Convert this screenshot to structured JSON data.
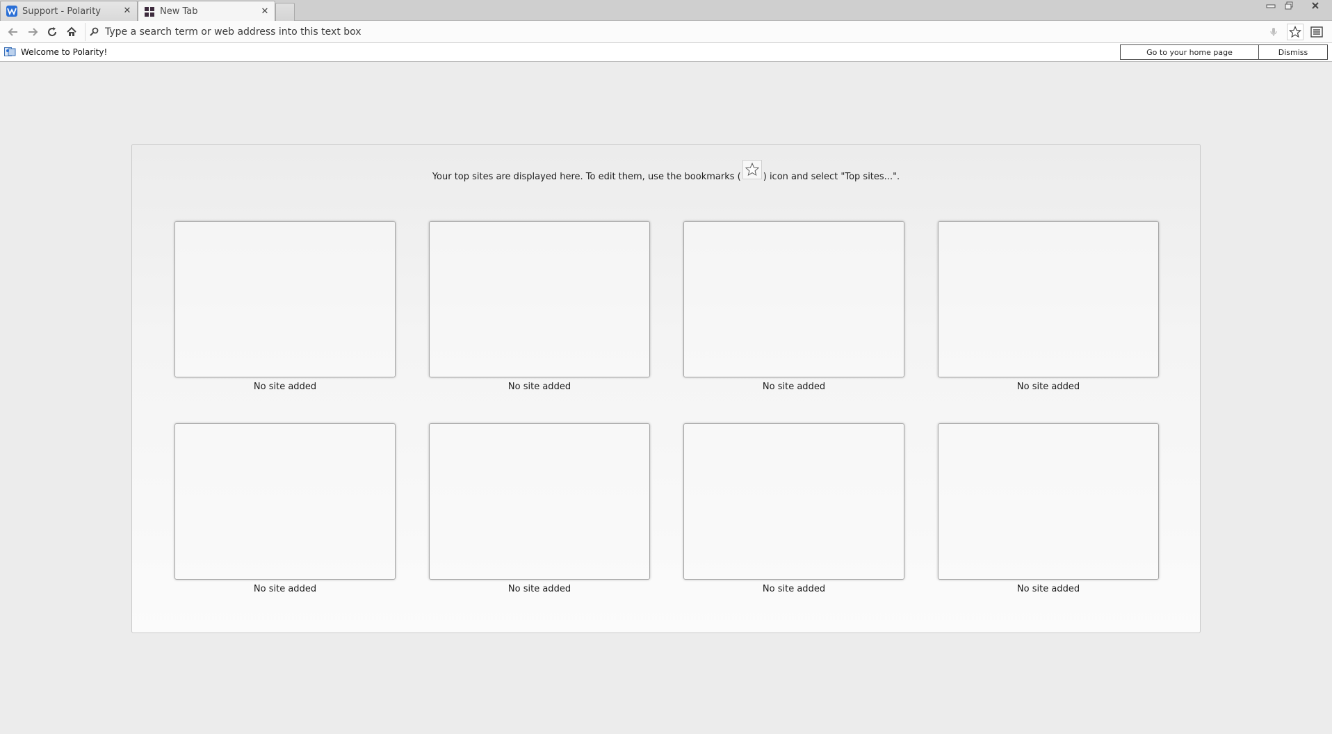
{
  "tabs": [
    {
      "label": "Support - Polarity",
      "active": false,
      "favicon": "w-logo-icon"
    },
    {
      "label": "New Tab",
      "active": true,
      "favicon": "grid-icon"
    }
  ],
  "url_bar": {
    "placeholder": "Type a search term or web address into this text box",
    "value": ""
  },
  "notification": {
    "text": "Welcome to Polarity!",
    "home_button": "Go to your home page",
    "dismiss_button": "Dismiss"
  },
  "top_sites": {
    "intro_before": "Your top sites are displayed here. To edit them, use the bookmarks (",
    "intro_after": ") icon and select \"Top sites...\".",
    "tiles": [
      {
        "caption": "No site added"
      },
      {
        "caption": "No site added"
      },
      {
        "caption": "No site added"
      },
      {
        "caption": "No site added"
      },
      {
        "caption": "No site added"
      },
      {
        "caption": "No site added"
      },
      {
        "caption": "No site added"
      },
      {
        "caption": "No site added"
      }
    ]
  },
  "colors": {
    "page_bg": "#ececec",
    "tabstrip_bg": "#cfcfcf",
    "accent_blue": "#2a6fd6"
  }
}
